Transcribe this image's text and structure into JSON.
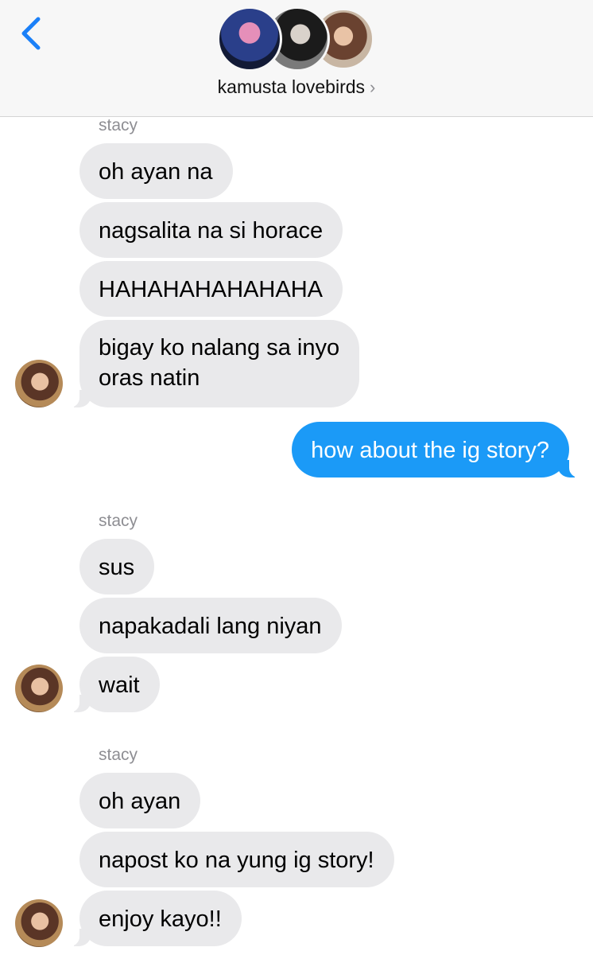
{
  "header": {
    "back_icon": "chevron-left-icon",
    "group_name": "kamusta lovebirds",
    "chevron": "›",
    "accent": "#1b80f8"
  },
  "messages": [
    {
      "sender": "stacy",
      "lines": [
        "oh ayan na",
        "nagsalita na si horace",
        "HAHAHAHAHAHAHA",
        "bigay ko nalang sa inyo\noras natin"
      ]
    },
    {
      "sender": "me",
      "lines": [
        "how about the ig story?"
      ]
    },
    {
      "sender": "stacy",
      "lines": [
        "sus",
        "napakadali lang niyan",
        "wait"
      ]
    },
    {
      "sender": "stacy",
      "lines": [
        "oh ayan",
        "napost ko na yung ig story!",
        "enjoy kayo!!"
      ]
    }
  ],
  "colors": {
    "incoming_bubble": "#e9e9eb",
    "outgoing_bubble": "#1b9af7"
  }
}
